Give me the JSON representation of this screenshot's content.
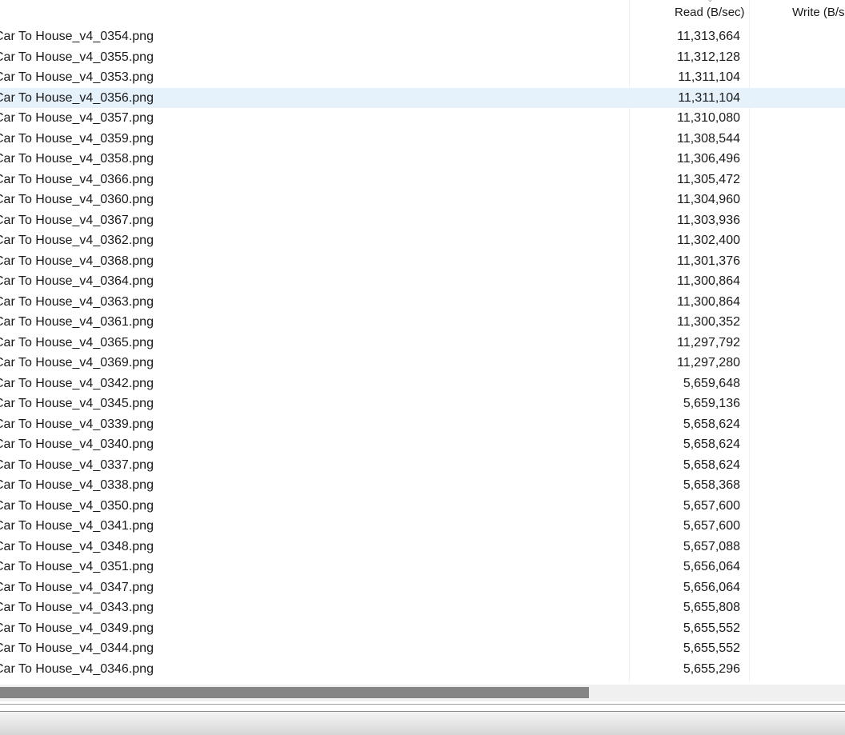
{
  "header": {
    "read_label": "Read (B/sec)",
    "write_label": "Write (B/s"
  },
  "files": [
    {
      "name": "Car To House_v4_0354.png",
      "read": "11,313,664"
    },
    {
      "name": "Car To House_v4_0355.png",
      "read": "11,312,128"
    },
    {
      "name": "Car To House_v4_0353.png",
      "read": "11,311,104"
    },
    {
      "name": "Car To House_v4_0356.png",
      "read": "11,311,104",
      "selected": true
    },
    {
      "name": "Car To House_v4_0357.png",
      "read": "11,310,080"
    },
    {
      "name": "Car To House_v4_0359.png",
      "read": "11,308,544"
    },
    {
      "name": "Car To House_v4_0358.png",
      "read": "11,306,496"
    },
    {
      "name": "Car To House_v4_0366.png",
      "read": "11,305,472"
    },
    {
      "name": "Car To House_v4_0360.png",
      "read": "11,304,960"
    },
    {
      "name": "Car To House_v4_0367.png",
      "read": "11,303,936"
    },
    {
      "name": "Car To House_v4_0362.png",
      "read": "11,302,400"
    },
    {
      "name": "Car To House_v4_0368.png",
      "read": "11,301,376"
    },
    {
      "name": "Car To House_v4_0364.png",
      "read": "11,300,864"
    },
    {
      "name": "Car To House_v4_0363.png",
      "read": "11,300,864"
    },
    {
      "name": "Car To House_v4_0361.png",
      "read": "11,300,352"
    },
    {
      "name": "Car To House_v4_0365.png",
      "read": "11,297,792"
    },
    {
      "name": "Car To House_v4_0369.png",
      "read": "11,297,280"
    },
    {
      "name": "Car To House_v4_0342.png",
      "read": "5,659,648"
    },
    {
      "name": "Car To House_v4_0345.png",
      "read": "5,659,136"
    },
    {
      "name": "Car To House_v4_0339.png",
      "read": "5,658,624"
    },
    {
      "name": "Car To House_v4_0340.png",
      "read": "5,658,624"
    },
    {
      "name": "Car To House_v4_0337.png",
      "read": "5,658,624"
    },
    {
      "name": "Car To House_v4_0338.png",
      "read": "5,658,368"
    },
    {
      "name": "Car To House_v4_0350.png",
      "read": "5,657,600"
    },
    {
      "name": "Car To House_v4_0341.png",
      "read": "5,657,600"
    },
    {
      "name": "Car To House_v4_0348.png",
      "read": "5,657,088"
    },
    {
      "name": "Car To House_v4_0351.png",
      "read": "5,656,064"
    },
    {
      "name": "Car To House_v4_0347.png",
      "read": "5,656,064"
    },
    {
      "name": "Car To House_v4_0343.png",
      "read": "5,655,808"
    },
    {
      "name": "Car To House_v4_0349.png",
      "read": "5,655,552"
    },
    {
      "name": "Car To House_v4_0344.png",
      "read": "5,655,552"
    },
    {
      "name": "Car To House_v4_0346.png",
      "read": "5,655,296"
    }
  ],
  "colors": {
    "selection": "#e5f1fb",
    "scroll_thumb": "#858585"
  }
}
